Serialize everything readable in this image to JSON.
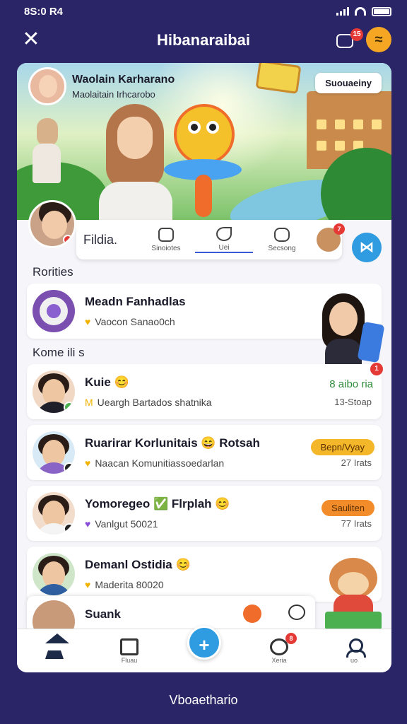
{
  "status_bar": {
    "time": "8S:0 R4"
  },
  "header": {
    "title": "Hibanaraibai",
    "chat_badge": "15",
    "coin_glyph": "≈"
  },
  "hero": {
    "user_name": "Waolain Karharano",
    "user_sub": "Maolaitain Irhcarobo",
    "subscribe_label": "Suouaeiny"
  },
  "profile_strip": {
    "name": "Fildia.",
    "tabs": [
      {
        "label": "Sinoiotes"
      },
      {
        "label": "Uei"
      },
      {
        "label": "Secsong"
      }
    ],
    "mascot_badge": "7"
  },
  "sections": {
    "routines": "Rorities",
    "komentis": "Kome ili s"
  },
  "featured": {
    "name": "Meadn Fanhadlas",
    "sub": "Vaocon Sanao0ch"
  },
  "items": [
    {
      "name": "Kuie 😊",
      "gem": "M",
      "sub": "Ueargh Bartados shatnika",
      "meta_top": "8 aibo ria",
      "meta_bottom": "13-Stoap",
      "badge": "1"
    },
    {
      "name": "Ruarirar Korlunitais 😄 Rotsah",
      "gem": "♥",
      "sub": "Naacan Komunitiassoedarlan",
      "pill": "Bepn/Vyay",
      "pill_color": "#f5b72a",
      "meta_bottom": "27 Irats"
    },
    {
      "name": "Yomoregeo ✅ Flrplah 😊",
      "gem": "♥",
      "sub": "Vanlgut 50021",
      "pill": "Sauliten",
      "pill_color": "#f28c2a",
      "meta_bottom": "77 Irats"
    },
    {
      "name": "Demanl Ostidia 😊",
      "gem": "♥",
      "sub": "Maderita 80020"
    }
  ],
  "mini_player": {
    "name": "Suank"
  },
  "bottom_nav": {
    "items": [
      {
        "label": ""
      },
      {
        "label": "Fluau"
      },
      {
        "label": ""
      },
      {
        "label": "Xeria",
        "badge": "8"
      },
      {
        "label": "uo"
      }
    ]
  },
  "footer": {
    "text": "Vboaethario"
  },
  "colors": {
    "background": "#2a2566",
    "accent": "#2f9be0",
    "badge": "#e53935"
  }
}
